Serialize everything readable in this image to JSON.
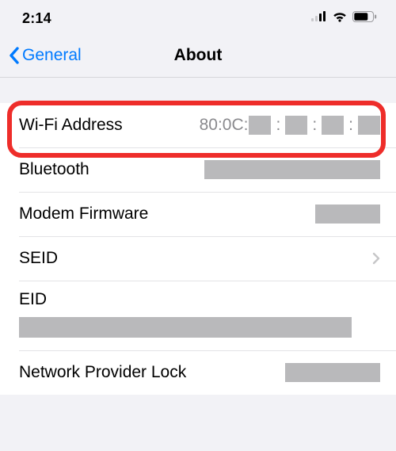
{
  "status": {
    "time": "2:14"
  },
  "nav": {
    "back_label": "General",
    "title": "About"
  },
  "rows": {
    "wifi": {
      "label": "Wi-Fi Address",
      "value_visible": "80:0C:"
    },
    "bluetooth": {
      "label": "Bluetooth"
    },
    "modem": {
      "label": "Modem Firmware"
    },
    "seid": {
      "label": "SEID"
    },
    "eid": {
      "label": "EID"
    },
    "nplock": {
      "label": "Network Provider Lock"
    }
  },
  "colors": {
    "link": "#007aff",
    "highlight": "#ee2d2a",
    "redact": "#b9b9bb"
  }
}
